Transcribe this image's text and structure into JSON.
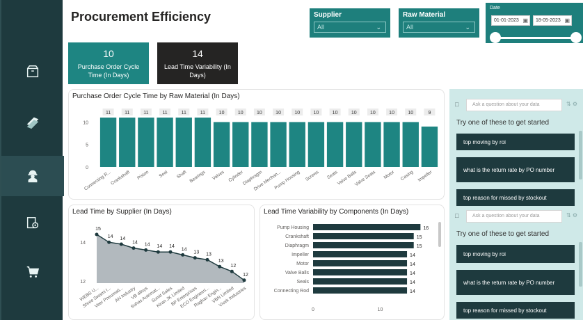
{
  "page": {
    "title": "Procurement Efficiency"
  },
  "nav": {
    "items": [
      "box-icon",
      "beam-icon",
      "worker-icon",
      "component-icon",
      "cart-icon"
    ],
    "active": 2
  },
  "filters": {
    "supplier": {
      "label": "Supplier",
      "value": "All"
    },
    "raw_material": {
      "label": "Raw Material",
      "value": "All"
    },
    "date": {
      "label": "Date",
      "start": "01-01-2023",
      "end": "18-05-2023",
      "range_fraction": [
        0,
        1
      ]
    }
  },
  "kpis": [
    {
      "value": "10",
      "label": "Purchase Order Cycle Time (In Days)",
      "color": "#1e8582"
    },
    {
      "value": "14",
      "label": "Lead Time Variability (In Days)",
      "color": "#252423"
    }
  ],
  "colors": {
    "sidebar": "#1e3a3e",
    "accent": "#1e8582",
    "area": "#a5adb3",
    "qa_bg": "#cfe9e8"
  },
  "chart_data": [
    {
      "type": "bar",
      "title": "Purchase Order Cycle Time by Raw Material (In Days)",
      "categories": [
        "Connecting R...",
        "Crankshaft",
        "Piston",
        "Seal",
        "Shaft",
        "Bearings",
        "Valves",
        "Cylinder",
        "Diaphragm",
        "Drive Mechan...",
        "Pump Housing",
        "Screws",
        "Seats",
        "Valve Balls",
        "Valve Seats",
        "Motor",
        "Casing",
        "Impeller"
      ],
      "values": [
        11,
        11,
        11,
        11,
        11,
        11,
        10,
        10,
        10,
        10,
        10,
        10,
        10,
        10,
        10,
        10,
        10,
        9
      ],
      "value_labels": [
        "11",
        "11",
        "11",
        "11",
        "11",
        "11",
        "10",
        "10",
        "10",
        "10",
        "10",
        "10",
        "10",
        "10",
        "10",
        "10",
        "10",
        "9"
      ],
      "yticks": [
        "10",
        "5",
        "0"
      ],
      "ylim": [
        0,
        11
      ]
    },
    {
      "type": "area",
      "title": "Lead Time by Supplier (In Days)",
      "categories": [
        "WEBS U...",
        "Shree Swami I...",
        "Veer Pneumati...",
        "AN Industry",
        "VB alloys",
        "Sohas Automat...",
        "Sumit Sales",
        "Kiran JK Limited",
        "BP Enterprises",
        "ECO Engineeri...",
        "Raghav Engin...",
        "VBN Limited",
        "Vivek Industries"
      ],
      "values": [
        14.4,
        14.0,
        13.9,
        13.7,
        13.6,
        13.5,
        13.5,
        13.35,
        13.2,
        13.1,
        12.75,
        12.5,
        12.05
      ],
      "point_labels": [
        "15",
        "14",
        "14",
        "14",
        "14",
        "14",
        "14",
        "14",
        "13",
        "13",
        "13",
        "12",
        "12"
      ],
      "yticks": [
        "14",
        "12"
      ],
      "ylim": [
        11.9,
        14.9
      ]
    },
    {
      "type": "bar",
      "orientation": "horizontal",
      "title": "Lead Time Variability by Components (In Days)",
      "categories": [
        "Pump Housing",
        "Crankshaft",
        "Diaphragm",
        "Impeller",
        "Motor",
        "Valve Balls",
        "Seals",
        "Connecting Rod"
      ],
      "values": [
        16,
        15,
        15,
        14,
        14,
        14,
        14,
        14
      ],
      "value_labels": [
        "16",
        "15",
        "15",
        "14",
        "14",
        "14",
        "14",
        "14"
      ],
      "xticks": [
        "0",
        "10"
      ],
      "xlim": [
        0,
        17
      ]
    }
  ],
  "qa": {
    "placeholder": "Ask a question about your data",
    "prompt": "Try one of these to get started",
    "suggestions": [
      "top moving by roi",
      "what is the return rate by PO number",
      "top reason for missed by stockout"
    ]
  }
}
